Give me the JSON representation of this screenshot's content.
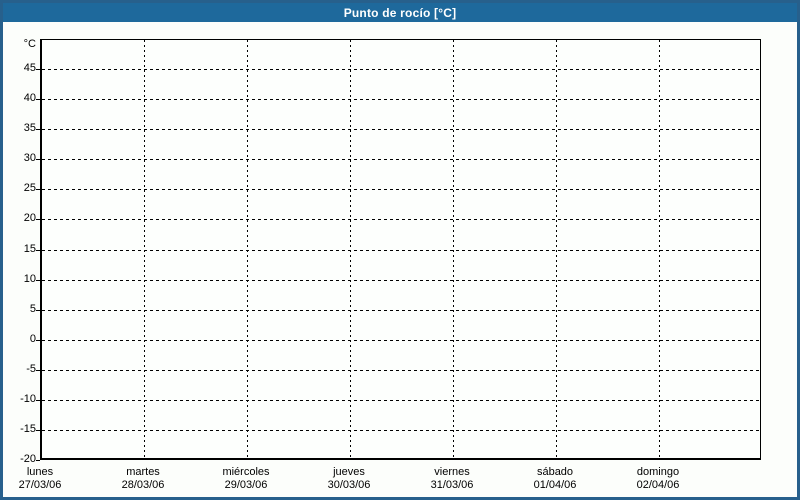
{
  "header": {
    "title": "Punto de rocío [°C]",
    "bg_color": "#1e699c",
    "text_color": "#ffffff"
  },
  "window": {
    "border_color": "#27608c",
    "bg_color": "#fcfefb"
  },
  "chart_data": {
    "type": "line",
    "title": "Punto de rocío [°C]",
    "ylabel": "°C",
    "xlabel": "",
    "ylim": [
      -20,
      50
    ],
    "ytick_interval": 5,
    "yticks": [
      45,
      40,
      35,
      30,
      25,
      20,
      15,
      10,
      5,
      0,
      -5,
      -10,
      -15,
      -20
    ],
    "grid": "dashed",
    "gridline_color": "#000000",
    "legend_position": "none",
    "series": [],
    "categories": [
      {
        "day": "lunes",
        "date": "27/03/06"
      },
      {
        "day": "martes",
        "date": "28/03/06"
      },
      {
        "day": "miércoles",
        "date": "29/03/06"
      },
      {
        "day": "jueves",
        "date": "30/03/06"
      },
      {
        "day": "viernes",
        "date": "31/03/06"
      },
      {
        "day": "sábado",
        "date": "01/04/06"
      },
      {
        "day": "domingo",
        "date": "02/04/06"
      }
    ]
  }
}
